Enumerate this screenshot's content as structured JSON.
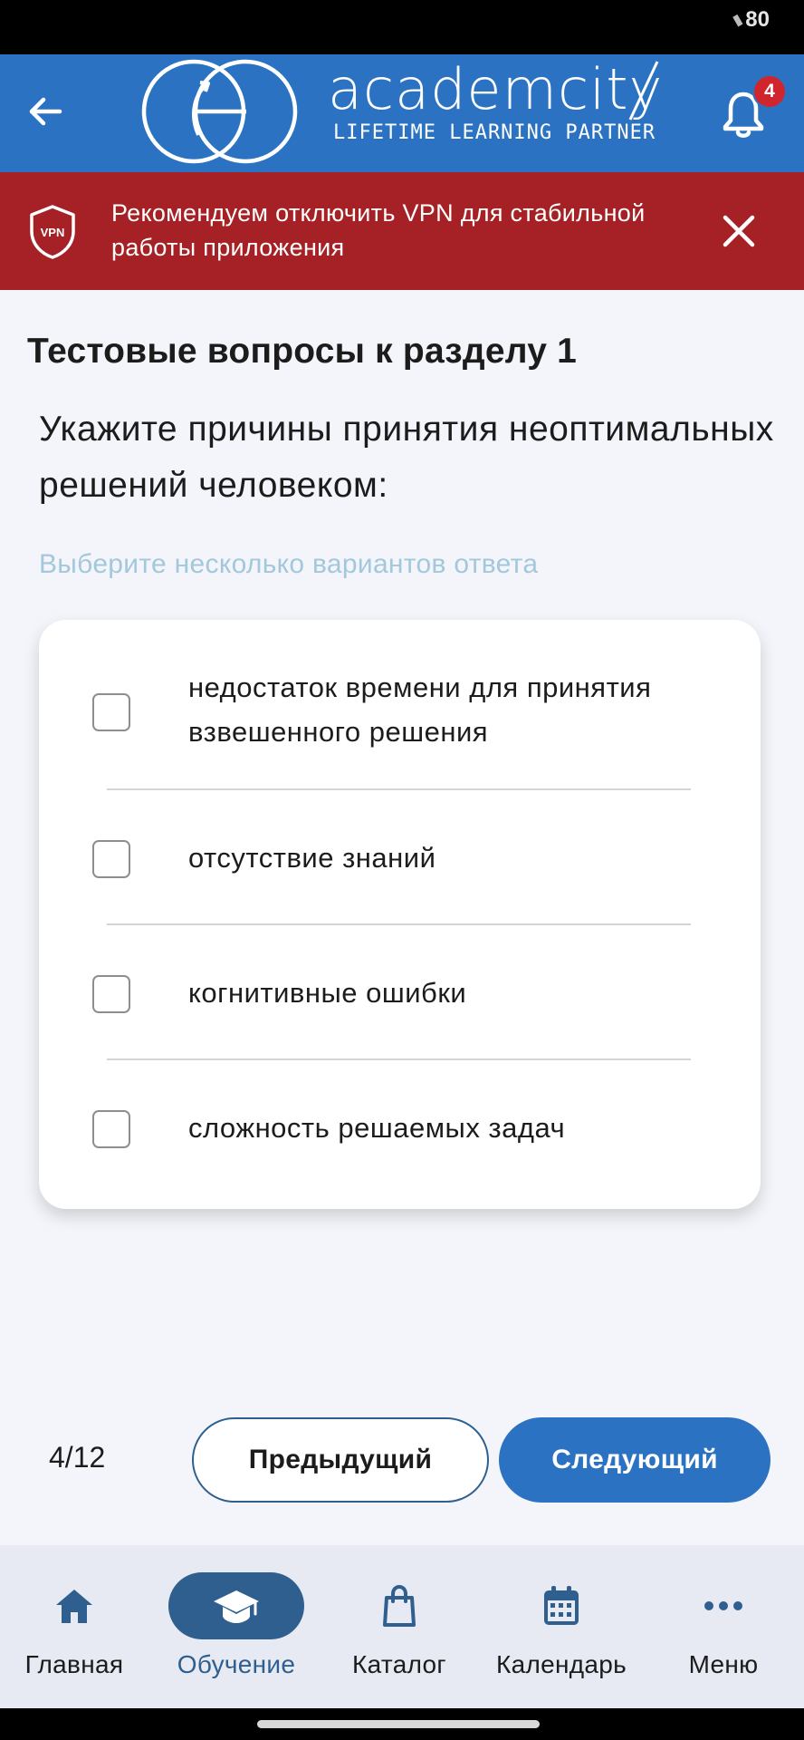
{
  "status_bar": {
    "battery": "80"
  },
  "header": {
    "logo_text": "academcity",
    "tagline": "LIFETIME LEARNING PARTNER",
    "notification_count": "4",
    "icons": {
      "back": "arrow-left-icon",
      "bell": "bell-icon"
    },
    "colors": {
      "background": "#2b73c2",
      "badge": "#d1252d"
    }
  },
  "vpn_banner": {
    "shield_label": "VPN",
    "message": "Рекомендуем отключить VPN для стабильной работы приложения",
    "colors": {
      "background": "#a62125"
    }
  },
  "quiz": {
    "section_title": "Тестовые вопросы к разделу 1",
    "question": "Укажите причины принятия неоптимальных решений человеком:",
    "hint": "Выберите несколько вариантов ответа",
    "options": [
      {
        "text": "недостаток времени для принятия взвешенного решения",
        "checked": false
      },
      {
        "text": "отсутствие знаний",
        "checked": false
      },
      {
        "text": "когнитивные ошибки",
        "checked": false
      },
      {
        "text": "сложность решаемых задач",
        "checked": false
      }
    ],
    "progress": "4/12",
    "prev_label": "Предыдущий",
    "next_label": "Следующий"
  },
  "bottom_nav": {
    "items": [
      {
        "label": "Главная",
        "icon": "home-icon",
        "active": false
      },
      {
        "label": "Обучение",
        "icon": "graduation-cap-icon",
        "active": true
      },
      {
        "label": "Каталог",
        "icon": "shopping-bag-icon",
        "active": false
      },
      {
        "label": "Календарь",
        "icon": "calendar-icon",
        "active": false
      },
      {
        "label": "Меню",
        "icon": "more-dots-icon",
        "active": false
      }
    ],
    "colors": {
      "active": "#2e5f8e"
    }
  }
}
